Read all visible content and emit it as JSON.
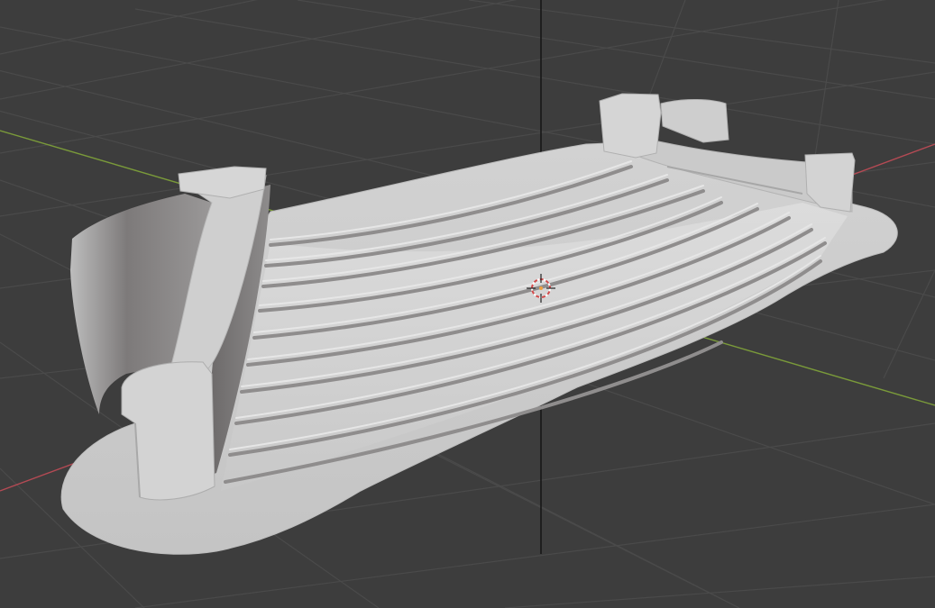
{
  "viewport": {
    "background_color": "#3d3d3d",
    "grid_color": "#4a4a4a",
    "x_axis_color": "#b44a54",
    "y_axis_color": "#7a9a3a",
    "z_axis_color": "#111111",
    "mesh_color": "#cfcfcf",
    "mesh_shadow_color": "#6a6868",
    "object_origin_icon": "3d-cursor-icon"
  }
}
